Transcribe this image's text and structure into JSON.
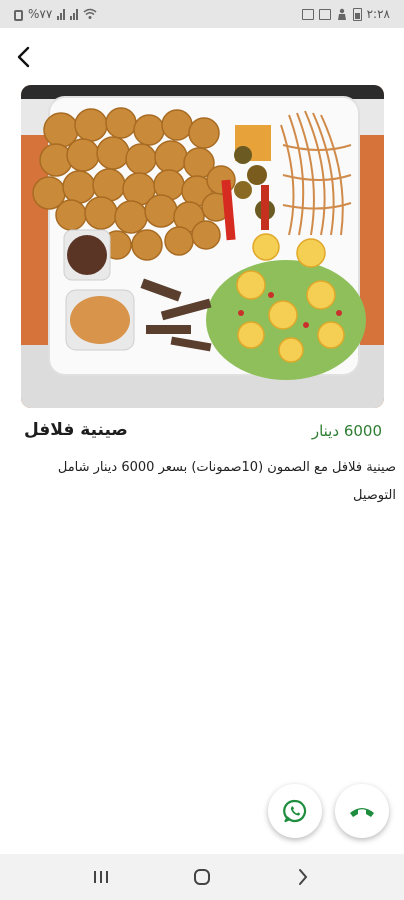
{
  "status_bar": {
    "left_text": "%٧٧",
    "time": "٢:٢٨",
    "icons": [
      "lock-icon",
      "signal-icon",
      "signal-icon",
      "wifi-icon",
      "image-icon",
      "gallery-icon",
      "person-icon",
      "battery-icon"
    ]
  },
  "header": {
    "back_icon": "chevron-left-icon"
  },
  "item": {
    "title": "صينية فلافل",
    "price_value": "6000",
    "price_currency": "دينار",
    "description": "صينية فلافل مع الصمون (10صمونات) بسعر 6000 دينار شامل التوصيل",
    "image_alt": "falafel platter with salad, noodles and sauces"
  },
  "actions": {
    "whatsapp_icon": "whatsapp-icon",
    "call_icon": "phone-icon",
    "call_color": "#1e8e3e",
    "whatsapp_color": "#1e8e3e"
  },
  "nav": {
    "recents_icon": "recents-icon",
    "home_icon": "home-icon",
    "back_icon": "back-chevron-icon"
  },
  "colors": {
    "price": "#2e7d32",
    "status_bar_bg": "#e6e6e6"
  }
}
